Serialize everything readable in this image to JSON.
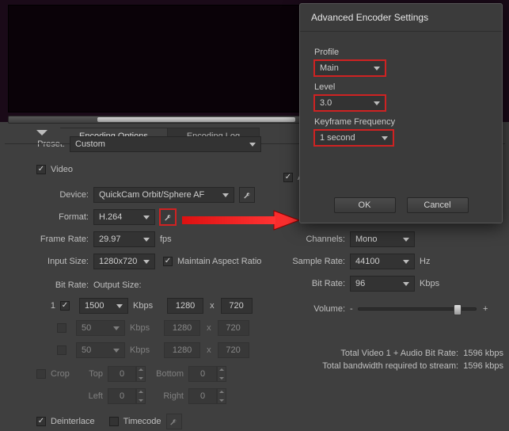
{
  "tabs": {
    "encoding_options": "Encoding Options",
    "encoding_log": "Encoding Log"
  },
  "preset": {
    "label": "Preset:",
    "value": "Custom"
  },
  "video": {
    "section": "Video",
    "device_label": "Device:",
    "device_value": "QuickCam Orbit/Sphere AF",
    "format_label": "Format:",
    "format_value": "H.264",
    "framerate_label": "Frame Rate:",
    "framerate_value": "29.97",
    "framerate_unit": "fps",
    "inputsize_label": "Input Size:",
    "inputsize_value": "1280x720",
    "aspect_label": "Maintain Aspect Ratio",
    "bitrate_label": "Bit Rate:",
    "outputsize_label": "Output Size:",
    "br_stream": "1",
    "br1": "1500",
    "br2": "50",
    "br3": "50",
    "kbps": "Kbps",
    "out_w": "1280",
    "out_h": "720",
    "x": "x",
    "crop": "Crop",
    "top": "Top",
    "bottom": "Bottom",
    "left": "Left",
    "right": "Right",
    "zero": "0",
    "deinterlace": "Deinterlace",
    "timecode": "Timecode"
  },
  "audio": {
    "section_prefix": "A",
    "channels_label": "Channels:",
    "channels_value": "Mono",
    "samplerate_label": "Sample Rate:",
    "samplerate_value": "44100",
    "hz": "Hz",
    "bitrate_label": "Bit Rate:",
    "bitrate_value": "96",
    "kbps": "Kbps",
    "volume_label": "Volume:",
    "minus": "-",
    "plus": "+"
  },
  "totals": {
    "video_audio_label": "Total Video 1 + Audio Bit Rate:",
    "bandwidth_label": "Total bandwidth required to stream:",
    "value": "1596 kbps"
  },
  "popup": {
    "title": "Advanced Encoder Settings",
    "profile_label": "Profile",
    "profile_value": "Main",
    "level_label": "Level",
    "level_value": "3.0",
    "keyframe_label": "Keyframe Frequency",
    "keyframe_value": "1 second",
    "ok": "OK",
    "cancel": "Cancel"
  }
}
